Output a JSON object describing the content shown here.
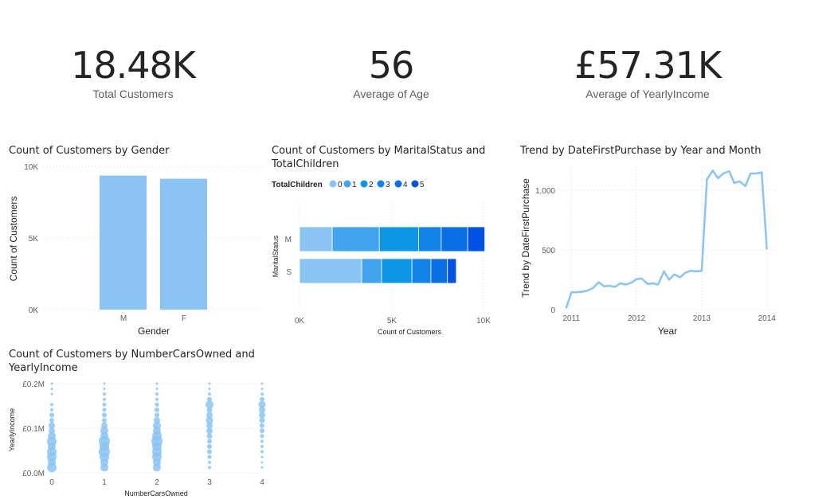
{
  "kpis": [
    {
      "value": "18.48K",
      "label": "Total Customers"
    },
    {
      "value": "56",
      "label": "Average of Age"
    },
    {
      "value": "£57.31K",
      "label": "Average of YearlyIncome"
    }
  ],
  "colors": {
    "primary": "#89c4f4",
    "children": [
      "#89c4f4",
      "#41a5ee",
      "#0f95e8",
      "#1183e8",
      "#0a6fe5",
      "#0052e6"
    ]
  },
  "gender_chart": {
    "title": "Count of Customers by Gender",
    "xlabel": "Gender",
    "ylabel": "Count of Customers",
    "ticks": [
      "0K",
      "5K",
      "10K"
    ],
    "ylim": [
      0,
      10000
    ],
    "categories": [
      "M",
      "F"
    ],
    "values": [
      9350,
      9130
    ]
  },
  "marital_chart": {
    "title_line1": "Count of Customers by MaritalStatus and",
    "title_line2": "TotalChildren",
    "legend_title": "TotalChildren",
    "legend": [
      "0",
      "1",
      "2",
      "3",
      "4",
      "5"
    ],
    "ylabel": "MaritalStatus",
    "xlabel": "Count of Customers",
    "ticks": [
      "0K",
      "5K",
      "10K"
    ],
    "xlim": [
      0,
      10000
    ],
    "categories": [
      "M",
      "S"
    ],
    "series": [
      {
        "name": "0",
        "values": [
          1780,
          3380
        ]
      },
      {
        "name": "1",
        "values": [
          2560,
          1080
        ]
      },
      {
        "name": "2",
        "values": [
          2130,
          1650
        ]
      },
      {
        "name": "3",
        "values": [
          1230,
          1030
        ]
      },
      {
        "name": "4",
        "values": [
          1440,
          900
        ]
      },
      {
        "name": "5",
        "values": [
          930,
          480
        ]
      }
    ]
  },
  "trend_chart": {
    "title": "Trend by DateFirstPurchase by Year and Month",
    "xlabel": "Year",
    "ylabel": "Trend by DateFirstPurchase",
    "yticks": [
      "0",
      "500",
      "1,000"
    ],
    "xticks": [
      "2011",
      "2012",
      "2013",
      "2014"
    ],
    "ylim": [
      0,
      1200
    ],
    "xlim": [
      2010.85,
      2014.15
    ],
    "points": [
      [
        2010.92,
        10
      ],
      [
        2011.0,
        145
      ],
      [
        2011.08,
        145
      ],
      [
        2011.17,
        150
      ],
      [
        2011.25,
        160
      ],
      [
        2011.33,
        180
      ],
      [
        2011.42,
        230
      ],
      [
        2011.5,
        195
      ],
      [
        2011.58,
        200
      ],
      [
        2011.67,
        190
      ],
      [
        2011.75,
        220
      ],
      [
        2011.83,
        210
      ],
      [
        2011.92,
        225
      ],
      [
        2012.0,
        255
      ],
      [
        2012.08,
        260
      ],
      [
        2012.17,
        215
      ],
      [
        2012.25,
        220
      ],
      [
        2012.33,
        210
      ],
      [
        2012.42,
        320
      ],
      [
        2012.5,
        250
      ],
      [
        2012.58,
        295
      ],
      [
        2012.67,
        270
      ],
      [
        2012.75,
        310
      ],
      [
        2012.83,
        325
      ],
      [
        2012.92,
        320
      ],
      [
        2013.0,
        325
      ],
      [
        2013.08,
        1090
      ],
      [
        2013.17,
        1165
      ],
      [
        2013.25,
        1100
      ],
      [
        2013.33,
        1140
      ],
      [
        2013.42,
        1160
      ],
      [
        2013.5,
        1060
      ],
      [
        2013.58,
        1075
      ],
      [
        2013.67,
        1035
      ],
      [
        2013.75,
        1140
      ],
      [
        2013.83,
        1140
      ],
      [
        2013.92,
        1150
      ],
      [
        2014.0,
        505
      ]
    ]
  },
  "scatter_chart": {
    "title_line1": "Count of Customers by NumberCarsOwned and",
    "title_line2": "YearlyIncome",
    "xlabel": "NumberCarsOwned",
    "ylabel": "YearlyIncome",
    "yticks": [
      "£0.0M",
      "£0.1M",
      "£0.2M"
    ],
    "xticks": [
      "0",
      "1",
      "2",
      "3",
      "4"
    ],
    "xlim": [
      0,
      4
    ],
    "ylim": [
      0,
      170000
    ],
    "groups": [
      {
        "cars": 0,
        "incomes": [
          10000,
          20000,
          30000,
          40000,
          50000,
          60000,
          70000,
          80000,
          90000,
          100000,
          110000,
          120000,
          130000,
          150000,
          160000,
          170000
        ],
        "sizes": [
          6,
          5,
          6,
          6,
          5,
          6,
          5,
          4,
          4,
          3,
          3,
          2,
          2,
          1.5,
          1.5,
          1.5
        ]
      },
      {
        "cars": 1,
        "incomes": [
          10000,
          20000,
          30000,
          40000,
          50000,
          60000,
          70000,
          80000,
          90000,
          100000,
          110000,
          120000,
          130000,
          140000,
          150000,
          160000,
          170000
        ],
        "sizes": [
          5,
          5,
          6,
          7,
          6,
          7,
          5,
          5,
          4,
          3,
          3,
          2.5,
          2.5,
          2,
          2,
          1.5,
          1.5
        ]
      },
      {
        "cars": 2,
        "incomes": [
          10000,
          20000,
          30000,
          40000,
          50000,
          60000,
          70000,
          80000,
          90000,
          100000,
          110000,
          120000,
          130000,
          140000,
          150000,
          160000,
          170000
        ],
        "sizes": [
          5,
          5,
          6,
          6,
          6,
          7,
          6,
          5,
          5,
          4,
          3,
          3,
          2.5,
          2,
          2,
          1.5,
          1.5
        ]
      },
      {
        "cars": 3,
        "incomes": [
          10000,
          20000,
          30000,
          40000,
          50000,
          60000,
          70000,
          80000,
          90000,
          100000,
          110000,
          120000,
          130000,
          140000,
          150000,
          160000,
          170000
        ],
        "sizes": [
          2,
          2,
          2.5,
          3,
          3,
          3,
          3.5,
          4,
          4,
          4.5,
          4,
          3.5,
          5,
          3,
          2,
          1.5,
          1.5
        ]
      },
      {
        "cars": 4,
        "incomes": [
          10000,
          20000,
          30000,
          40000,
          50000,
          60000,
          70000,
          80000,
          90000,
          100000,
          110000,
          120000,
          130000,
          140000,
          150000,
          160000,
          170000
        ],
        "sizes": [
          1.5,
          1.5,
          1.5,
          2,
          2,
          2,
          2.5,
          3,
          3,
          3.5,
          4,
          4,
          4.5,
          3,
          2,
          1.5,
          1.5
        ]
      }
    ]
  }
}
